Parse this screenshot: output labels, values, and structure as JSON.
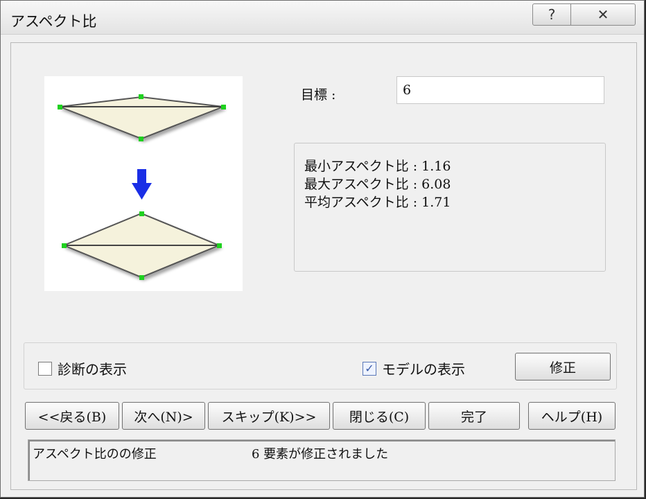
{
  "window": {
    "title": "アスペクト比",
    "help_glyph": "?",
    "close_glyph": "✕"
  },
  "form": {
    "target_label": "目標 :",
    "target_value": "6"
  },
  "stats": {
    "min": "最小アスペクト比 : 1.16",
    "max": "最大アスペクト比 : 6.08",
    "avg": "平均アスペクト比 : 1.71"
  },
  "options": {
    "diagnostic": {
      "label": "診断の表示",
      "checked": false
    },
    "model": {
      "label": "モデルの表示",
      "checked": true
    },
    "fix_button": "修正"
  },
  "nav_buttons": [
    "<<戻る(B)",
    "次へ(N)>",
    "スキップ(K)>>",
    "閉じる(C)",
    "完了",
    "ヘルプ(H)"
  ],
  "status": {
    "text1": "アスペクト比のの修正",
    "text2": "6 要素が修正されました"
  },
  "colors": {
    "shape_fill": "#f5f2dc",
    "node": "#1fd11f",
    "arrow": "#1a2ee6"
  }
}
